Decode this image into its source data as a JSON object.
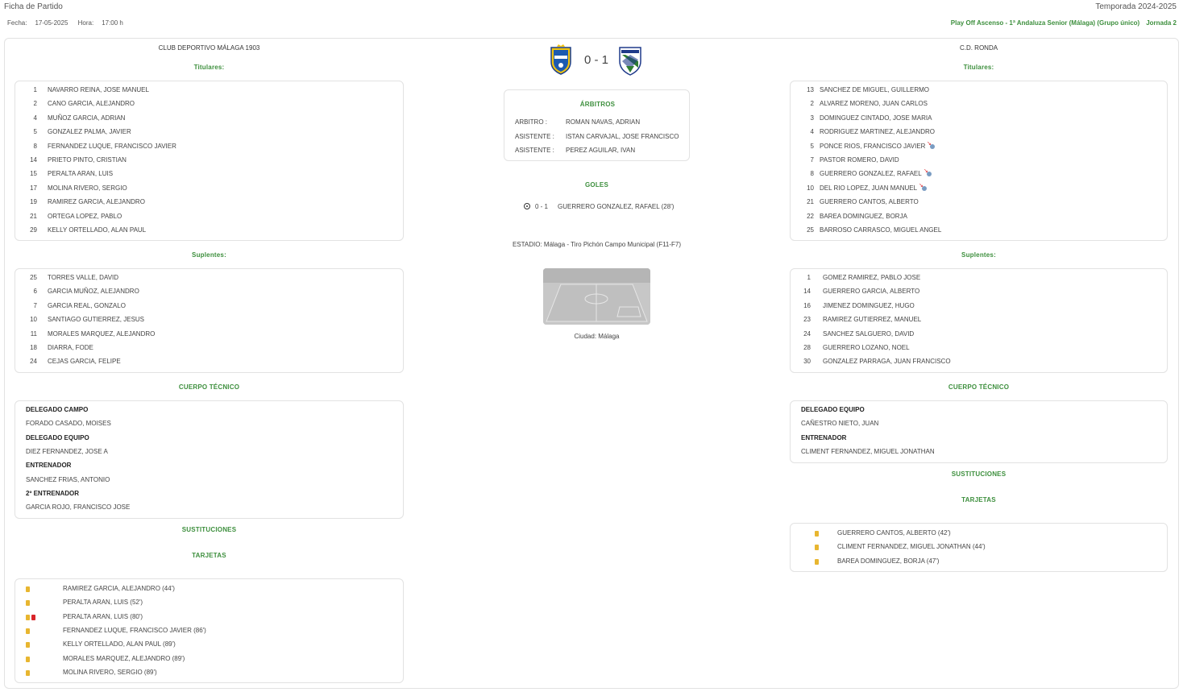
{
  "header": {
    "page_title": "Ficha de Partido",
    "season": "Temporada 2024-2025",
    "date_label": "Fecha:",
    "date": "17-05-2025",
    "time_label": "Hora:",
    "time": "17:00 h",
    "competition": "Play Off Ascenso - 1ª Andaluza Senior (Málaga) (Grupo único)",
    "round": "Jornada 2"
  },
  "match": {
    "score": "0 - 1",
    "referees_title": "ÁRBITROS",
    "referees": [
      {
        "role": "ARBITRO :",
        "name": "ROMAN NAVAS, ADRIAN"
      },
      {
        "role": "ASISTENTE :",
        "name": "ISTAN CARVAJAL, JOSE FRANCISCO"
      },
      {
        "role": "ASISTENTE :",
        "name": "PEREZ AGUILAR, IVAN"
      }
    ],
    "goals_title": "GOLES",
    "goals": [
      {
        "score": "0 - 1",
        "player": "GUERRERO GONZALEZ, RAFAEL (28')"
      }
    ],
    "stadium": "ESTADIO: Málaga - Tiro Pichón Campo Municipal (F11-F7)",
    "city": "Ciudad: Málaga"
  },
  "home": {
    "name": "CLUB DEPORTIVO MÁLAGA 1903",
    "starters_title": "Titulares:",
    "starters": [
      {
        "num": "1",
        "name": "NAVARRO REINA, JOSE MANUEL"
      },
      {
        "num": "2",
        "name": "CANO GARCIA, ALEJANDRO"
      },
      {
        "num": "4",
        "name": "MUÑOZ GARCIA, ADRIAN"
      },
      {
        "num": "5",
        "name": "GONZALEZ PALMA, JAVIER"
      },
      {
        "num": "8",
        "name": "FERNANDEZ LUQUE, FRANCISCO JAVIER"
      },
      {
        "num": "14",
        "name": "PRIETO PINTO, CRISTIAN"
      },
      {
        "num": "15",
        "name": "PERALTA ARAN, LUIS"
      },
      {
        "num": "17",
        "name": "MOLINA RIVERO, SERGIO"
      },
      {
        "num": "19",
        "name": "RAMIREZ GARCIA, ALEJANDRO"
      },
      {
        "num": "21",
        "name": "ORTEGA LOPEZ, PABLO"
      },
      {
        "num": "29",
        "name": "KELLY ORTELLADO, ALAN PAUL"
      }
    ],
    "subs_title": "Suplentes:",
    "subs": [
      {
        "num": "25",
        "name": "TORRES VALLE, DAVID"
      },
      {
        "num": "6",
        "name": "GARCIA MUÑOZ, ALEJANDRO"
      },
      {
        "num": "7",
        "name": "GARCIA REAL, GONZALO"
      },
      {
        "num": "10",
        "name": "SANTIAGO GUTIERREZ, JESUS"
      },
      {
        "num": "11",
        "name": "MORALES MARQUEZ, ALEJANDRO"
      },
      {
        "num": "18",
        "name": "DIARRA, FODE"
      },
      {
        "num": "24",
        "name": "CEJAS GARCIA, FELIPE"
      }
    ],
    "staff_title": "CUERPO TÉCNICO",
    "staff": [
      {
        "role": "DELEGADO CAMPO",
        "name": "FORADO CASADO, MOISES"
      },
      {
        "role": "DELEGADO EQUIPO",
        "name": "DIEZ FERNANDEZ, JOSE A"
      },
      {
        "role": "ENTRENADOR",
        "name": "SANCHEZ FRIAS, ANTONIO"
      },
      {
        "role": "2º ENTRENADOR",
        "name": "GARCIA ROJO, FRANCISCO JOSE"
      }
    ],
    "substitutions_title": "SUSTITUCIONES",
    "cards_title": "TARJETAS",
    "cards": [
      {
        "text": "RAMIREZ GARCIA, ALEJANDRO (44')",
        "type": "yellow"
      },
      {
        "text": "PERALTA ARAN, LUIS (52')",
        "type": "yellow"
      },
      {
        "text": "PERALTA ARAN, LUIS (80')",
        "type": "yellow-red"
      },
      {
        "text": "FERNANDEZ LUQUE, FRANCISCO JAVIER (86')",
        "type": "yellow"
      },
      {
        "text": "KELLY ORTELLADO, ALAN PAUL (89')",
        "type": "yellow"
      },
      {
        "text": "MORALES MARQUEZ, ALEJANDRO (89')",
        "type": "yellow"
      },
      {
        "text": "MOLINA RIVERO, SERGIO (89')",
        "type": "yellow"
      }
    ]
  },
  "away": {
    "name": "C.D. RONDA",
    "starters_title": "Titulares:",
    "starters": [
      {
        "num": "13",
        "name": "SANCHEZ DE MIGUEL, GUILLERMO",
        "subbed": false
      },
      {
        "num": "2",
        "name": "ALVAREZ MORENO, JUAN CARLOS",
        "subbed": false
      },
      {
        "num": "3",
        "name": "DOMINGUEZ CINTADO, JOSE MARIA",
        "subbed": false
      },
      {
        "num": "4",
        "name": "RODRIGUEZ MARTINEZ, ALEJANDRO",
        "subbed": false
      },
      {
        "num": "5",
        "name": "PONCE RIOS, FRANCISCO JAVIER",
        "subbed": true
      },
      {
        "num": "7",
        "name": "PASTOR ROMERO, DAVID",
        "subbed": false
      },
      {
        "num": "8",
        "name": "GUERRERO GONZALEZ, RAFAEL",
        "subbed": true
      },
      {
        "num": "10",
        "name": "DEL RIO LOPEZ, JUAN MANUEL",
        "subbed": true
      },
      {
        "num": "21",
        "name": "GUERRERO CANTOS, ALBERTO",
        "subbed": false
      },
      {
        "num": "22",
        "name": "BAREA DOMINGUEZ, BORJA",
        "subbed": false
      },
      {
        "num": "25",
        "name": "BARROSO CARRASCO, MIGUEL ANGEL",
        "subbed": false
      }
    ],
    "subs_title": "Suplentes:",
    "subs": [
      {
        "num": "1",
        "name": "GOMEZ RAMIREZ, PABLO JOSE"
      },
      {
        "num": "14",
        "name": "GUERRERO GARCIA, ALBERTO"
      },
      {
        "num": "16",
        "name": "JIMENEZ DOMINGUEZ, HUGO"
      },
      {
        "num": "23",
        "name": "RAMIREZ GUTIERREZ, MANUEL"
      },
      {
        "num": "24",
        "name": "SANCHEZ SALGUERO, DAVID"
      },
      {
        "num": "28",
        "name": "GUERRERO LOZANO, NOEL"
      },
      {
        "num": "30",
        "name": "GONZALEZ PARRAGA, JUAN FRANCISCO"
      }
    ],
    "staff_title": "CUERPO TÉCNICO",
    "staff": [
      {
        "role": "DELEGADO EQUIPO",
        "name": "CAÑESTRO NIETO, JUAN"
      },
      {
        "role": "ENTRENADOR",
        "name": "CLIMENT FERNANDEZ, MIGUEL JONATHAN"
      }
    ],
    "substitutions_title": "SUSTITUCIONES",
    "cards_title": "TARJETAS",
    "cards": [
      {
        "text": "GUERRERO CANTOS, ALBERTO (42')",
        "type": "yellow"
      },
      {
        "text": "CLIMENT FERNANDEZ, MIGUEL JONATHAN (44')",
        "type": "yellow"
      },
      {
        "text": "BAREA DOMINGUEZ, BORJA (47')",
        "type": "yellow"
      }
    ]
  },
  "colors": {
    "accent_green": "#3d8f3d",
    "border": "#e2e2e2",
    "yellow_card": "#e8b630",
    "red_card": "#d9252a"
  }
}
